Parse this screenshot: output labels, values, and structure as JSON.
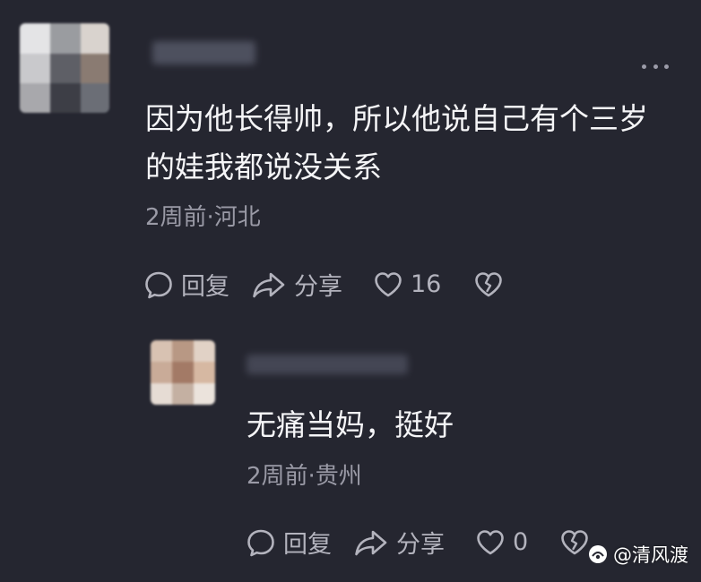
{
  "comment": {
    "text": "因为他长得帅，所以他说自己有个三岁的娃我都说没关系",
    "meta": "2周前·河北",
    "actions": {
      "reply_label": "回复",
      "share_label": "分享",
      "like_count": "16"
    }
  },
  "reply": {
    "text": "无痛当妈，挺好",
    "meta": "2周前·贵州",
    "actions": {
      "reply_label": "回复",
      "share_label": "分享",
      "like_count": "0"
    }
  },
  "watermark": {
    "text": "@清风渡"
  },
  "colors": {
    "background": "#252630",
    "primary_text": "#f5f5f7",
    "secondary_text": "#9a9aa6",
    "icon": "#b3b3bd"
  },
  "icons": {
    "reply": "speech-bubble-icon",
    "share": "share-arrow-icon",
    "like": "heart-icon",
    "dislike": "broken-heart-icon",
    "more": "more-dots-icon"
  }
}
